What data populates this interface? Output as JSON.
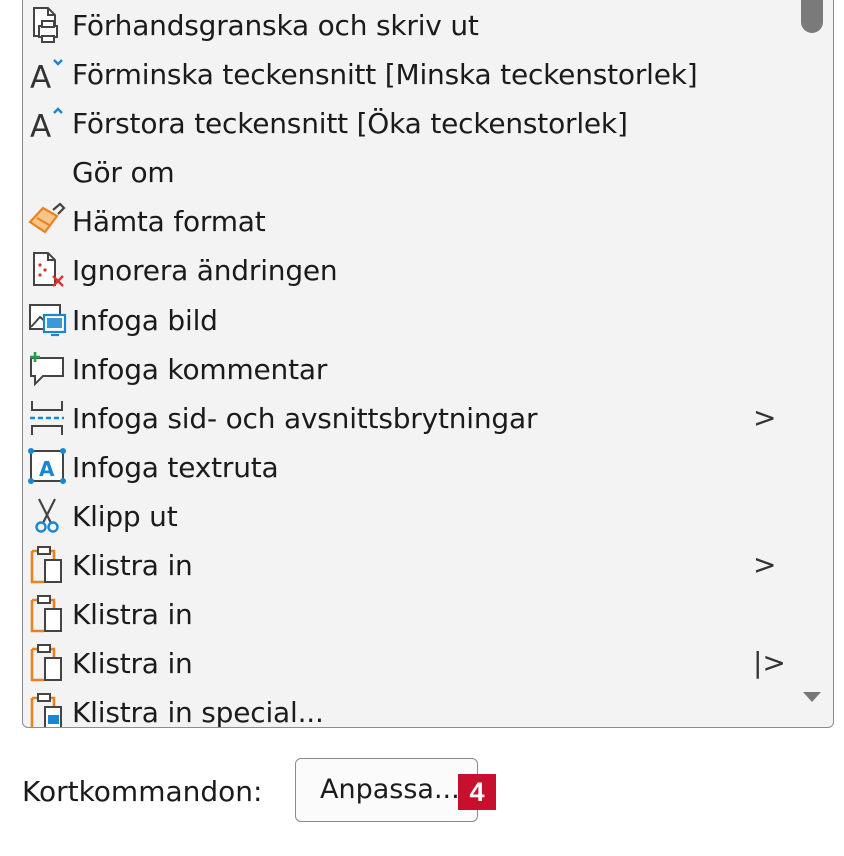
{
  "commands": {
    "items": [
      {
        "label": "Förhandsgranska och skriv ut",
        "icon": "print-preview-icon",
        "submenu": ""
      },
      {
        "label": "Förminska teckensnitt [Minska teckenstorlek]",
        "icon": "shrink-font-icon",
        "submenu": ""
      },
      {
        "label": "Förstora teckensnitt [Öka teckenstorlek]",
        "icon": "grow-font-icon",
        "submenu": ""
      },
      {
        "label": "Gör om",
        "icon": "",
        "submenu": ""
      },
      {
        "label": "Hämta format",
        "icon": "format-painter-icon",
        "submenu": ""
      },
      {
        "label": "Ignorera ändringen",
        "icon": "reject-change-icon",
        "submenu": ""
      },
      {
        "label": "Infoga bild",
        "icon": "insert-picture-icon",
        "submenu": ""
      },
      {
        "label": "Infoga kommentar",
        "icon": "insert-comment-icon",
        "submenu": ""
      },
      {
        "label": "Infoga sid- och avsnittsbrytningar",
        "icon": "page-break-icon",
        "submenu": ">"
      },
      {
        "label": "Infoga textruta",
        "icon": "text-box-icon",
        "submenu": ""
      },
      {
        "label": "Klipp ut",
        "icon": "scissors-icon",
        "submenu": ""
      },
      {
        "label": "Klistra in",
        "icon": "paste-icon",
        "submenu": ">"
      },
      {
        "label": "Klistra in",
        "icon": "paste-icon",
        "submenu": ""
      },
      {
        "label": "Klistra in",
        "icon": "paste-icon",
        "submenu": "|>"
      },
      {
        "label": "Klistra in special...",
        "icon": "paste-special-icon",
        "submenu": ""
      }
    ]
  },
  "footer": {
    "shortcut_label": "Kortkommandon:",
    "customize_label": "Anpassa...",
    "callout_number": "4"
  },
  "colors": {
    "accent_blue": "#1a86d1",
    "accent_orange": "#e8821e",
    "accent_red": "#d9342b",
    "accent_green": "#1f9e4a",
    "callout_red": "#c8102e",
    "list_background": "#f3f3f3"
  }
}
